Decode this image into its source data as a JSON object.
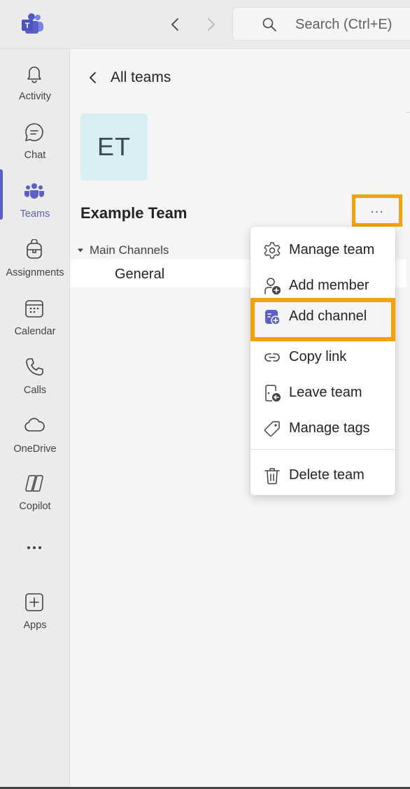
{
  "header": {
    "search_placeholder": "Search (Ctrl+E)"
  },
  "rail": {
    "items": [
      {
        "label": "Activity",
        "icon": "bell-icon"
      },
      {
        "label": "Chat",
        "icon": "chat-icon"
      },
      {
        "label": "Teams",
        "icon": "teams-icon",
        "active": true
      },
      {
        "label": "Assignments",
        "icon": "backpack-icon"
      },
      {
        "label": "Calendar",
        "icon": "calendar-icon"
      },
      {
        "label": "Calls",
        "icon": "phone-icon"
      },
      {
        "label": "OneDrive",
        "icon": "cloud-icon"
      },
      {
        "label": "Copilot",
        "icon": "copilot-icon"
      },
      {
        "label": "Apps",
        "icon": "add-apps-icon"
      }
    ]
  },
  "panel": {
    "back_label": "All teams",
    "team_initials": "ET",
    "team_name": "Example Team",
    "more_label": "...",
    "section_label": "Main Channels",
    "channel_label": "General"
  },
  "menu": {
    "items": [
      {
        "label": "Manage team",
        "icon": "gear-icon"
      },
      {
        "label": "Add member",
        "icon": "add-person-icon"
      },
      {
        "label": "Add channel",
        "icon": "add-channel-icon",
        "highlighted": true
      },
      {
        "label": "Copy link",
        "icon": "link-icon"
      },
      {
        "label": "Leave team",
        "icon": "leave-door-icon"
      },
      {
        "label": "Manage tags",
        "icon": "tag-icon"
      },
      {
        "label": "Delete team",
        "icon": "trash-icon"
      }
    ]
  },
  "colors": {
    "accent": "#5b5fc7",
    "highlight_border": "#f7a10a",
    "rail_bg": "#ebebeb",
    "panel_bg": "#f5f5f5"
  }
}
